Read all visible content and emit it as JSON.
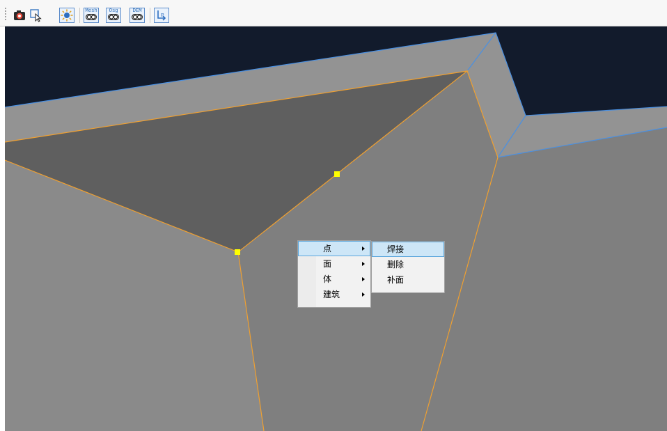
{
  "toolbar": {
    "buttons": [
      {
        "name": "camera-icon"
      },
      {
        "name": "select-cursor-icon"
      },
      {
        "name": "light-sun-icon"
      },
      {
        "name": "mesh-toggle",
        "label": "Mesh"
      },
      {
        "name": "osg-toggle",
        "label": "Osg"
      },
      {
        "name": "dem-toggle",
        "label": "DEM"
      },
      {
        "name": "export-icon"
      }
    ]
  },
  "colors": {
    "sky": "#121b2c",
    "roof": "#939393",
    "selected_face": "#5f5f5f",
    "wall": "#7f7f7f",
    "edge_orange": "#f0a030",
    "edge_blue": "#4a90e2",
    "vertex": "#ffff00"
  },
  "context_menu": {
    "items": [
      {
        "label": "点",
        "has_submenu": true,
        "highlighted": true
      },
      {
        "label": "面",
        "has_submenu": true
      },
      {
        "label": "体",
        "has_submenu": true
      },
      {
        "label": "建筑",
        "has_submenu": true
      }
    ],
    "submenu": {
      "items": [
        {
          "label": "焊接",
          "highlighted": true
        },
        {
          "label": "删除"
        },
        {
          "label": "补面"
        }
      ]
    }
  }
}
